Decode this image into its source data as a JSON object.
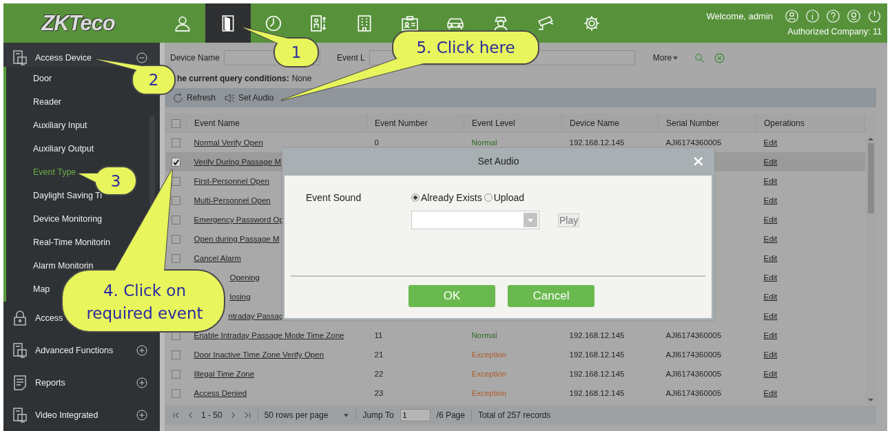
{
  "header": {
    "logo": "ZKTeco",
    "nav": [
      {
        "selected": false
      },
      {
        "selected": true
      },
      {
        "selected": false
      },
      {
        "selected": false
      },
      {
        "selected": false
      },
      {
        "selected": false
      },
      {
        "selected": false
      },
      {
        "selected": false
      },
      {
        "selected": false
      },
      {
        "selected": false
      }
    ],
    "welcome": "Welcome, admin",
    "company": "Authorized Company: 11"
  },
  "sidebar": {
    "groups": [
      {
        "label": "Access Device",
        "expanded": true,
        "children": [
          {
            "label": "Door",
            "selected": false
          },
          {
            "label": "Reader",
            "selected": false
          },
          {
            "label": "Auxiliary Input",
            "selected": false
          },
          {
            "label": "Auxiliary Output",
            "selected": false
          },
          {
            "label": "Event Type",
            "selected": true
          },
          {
            "label": "Daylight Saving Ti",
            "selected": false
          },
          {
            "label": "Device Monitoring",
            "selected": false
          },
          {
            "label": "Real-Time Monitorin",
            "selected": false
          },
          {
            "label": "Alarm Monitorin",
            "selected": false
          },
          {
            "label": "Map",
            "selected": false
          }
        ]
      },
      {
        "label": "Access"
      },
      {
        "label": "Advanced Functions",
        "expanded": false
      },
      {
        "label": "Reports",
        "expanded": false
      },
      {
        "label": "Video Integrated",
        "expanded": false
      }
    ]
  },
  "filters": {
    "fields": [
      {
        "label": "Device Name"
      },
      {
        "label": "Event L"
      }
    ],
    "more": "More",
    "query_label": "he current query conditions:",
    "query_value": "None"
  },
  "toolbar": [
    {
      "label": "Refresh"
    },
    {
      "label": "Set Audio"
    }
  ],
  "table": {
    "header_checked": false,
    "columns": [
      "Event Name",
      "Event Number",
      "Event Level",
      "Device Name",
      "Serial Number",
      "Operations"
    ],
    "rows": [
      {
        "checked": false,
        "selected": false,
        "name": "Normal Verify Open",
        "number": "0",
        "level": "Normal",
        "color": "#2c6a24",
        "device": "192.168.12.145",
        "serial": "AJI6174360005",
        "operation": "Edit"
      },
      {
        "checked": true,
        "selected": true,
        "name": "Verify During Passage M",
        "operation": "Edit"
      },
      {
        "checked": false,
        "selected": false,
        "name": "First-Personnel Open",
        "operation": "Edit"
      },
      {
        "checked": false,
        "selected": false,
        "name": "Multi-Personnel Open",
        "operation": "Edit"
      },
      {
        "checked": false,
        "selected": false,
        "name": "Emergency Password Op",
        "operation": "Edit"
      },
      {
        "checked": false,
        "selected": false,
        "name": "Open during Passage M",
        "operation": "Edit"
      },
      {
        "checked": false,
        "selected": false,
        "name": "Cancel Alarm",
        "operation": "Edit"
      },
      {
        "selected": false,
        "name": "Opening",
        "operation": "Edit"
      },
      {
        "selected": false,
        "name": "losing",
        "operation": "Edit"
      },
      {
        "selected": false,
        "name": "ntraday Passag",
        "operation": "Edit"
      },
      {
        "checked": false,
        "selected": false,
        "name": "Enable Intraday Passage Mode Time Zone",
        "number": "11",
        "level": "Normal",
        "color": "#2c6a24",
        "device": "192.168.12.145",
        "serial": "AJI6174360005",
        "operation": "Edit"
      },
      {
        "checked": false,
        "selected": false,
        "name": "Door Inactive Time Zone Verify Open",
        "number": "21",
        "level": "Exception",
        "color": "#b05a2a",
        "device": "192.168.12.145",
        "serial": "AJI6174360005",
        "operation": "Edit"
      },
      {
        "checked": false,
        "selected": false,
        "name": "Illegal Time Zone",
        "number": "22",
        "level": "Exception",
        "color": "#b05a2a",
        "device": "192.168.12.145",
        "serial": "AJI6174360005",
        "operation": "Edit"
      },
      {
        "checked": false,
        "selected": false,
        "name": "Access Denied",
        "number": "23",
        "level": "Exception",
        "color": "#b05a2a",
        "device": "192.168.12.145",
        "serial": "AJI6174360005",
        "operation": "Edit"
      }
    ]
  },
  "pager": {
    "range": "1 - 50",
    "page_size": "50 rows per page",
    "jump_label": "Jump To",
    "jump_value": "1",
    "pages": "/6 Page",
    "total": "Total of 257 records"
  },
  "dialog": {
    "title": "Set Audio",
    "close": "×",
    "field_label": "Event Sound",
    "options": [
      {
        "label": "Already Exists",
        "selected": true
      },
      {
        "label": "Upload",
        "selected": false
      }
    ],
    "play": {
      "label": "Play",
      "disabled": true
    },
    "buttons": [
      "OK",
      "Cancel"
    ]
  },
  "callouts": [
    {
      "lines": [
        "1"
      ]
    },
    {
      "lines": [
        "2"
      ]
    },
    {
      "lines": [
        "3"
      ]
    },
    {
      "lines": [
        "4. Click on",
        "required event"
      ]
    },
    {
      "lines": [
        "5. Click here"
      ]
    }
  ]
}
